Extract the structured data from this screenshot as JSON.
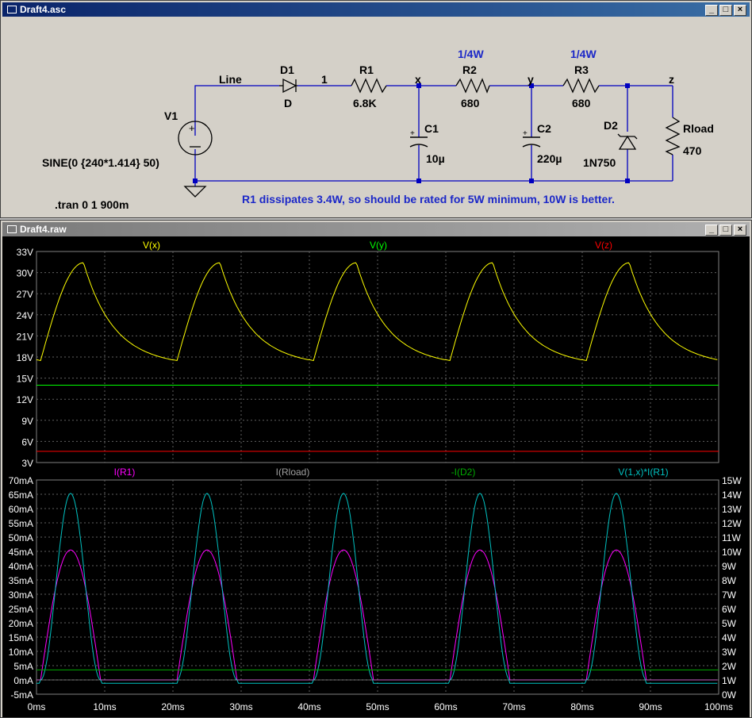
{
  "schematic_window": {
    "title": "Draft4.asc",
    "controls": {
      "minimize": "_",
      "restore": "□",
      "close": "×"
    },
    "components": {
      "V1": {
        "name": "V1",
        "value": "SINE(0 {240*1.414} 50)"
      },
      "D1": {
        "name": "D1",
        "value": "D"
      },
      "R1": {
        "name": "R1",
        "value": "6.8K"
      },
      "R2": {
        "name": "R2",
        "value": "680",
        "rating": "1/4W"
      },
      "R3": {
        "name": "R3",
        "value": "680",
        "rating": "1/4W"
      },
      "C1": {
        "name": "C1",
        "value": "10µ"
      },
      "C2": {
        "name": "C2",
        "value": "220µ"
      },
      "D2": {
        "name": "D2",
        "value": "1N750"
      },
      "Rload": {
        "name": "Rload",
        "value": "470"
      }
    },
    "nets": {
      "line": "Line",
      "n1": "1",
      "x": "x",
      "y": "y",
      "z": "z"
    },
    "directive": ".tran 0 1 900m",
    "comment": "R1 dissipates 3.4W, so should be rated for 5W minimum, 10W is better."
  },
  "waveform_window": {
    "title": "Draft4.raw",
    "controls": {
      "minimize": "_",
      "restore": "□",
      "close": "×"
    }
  },
  "chart_data": [
    {
      "type": "line",
      "pane": "top",
      "series": [
        {
          "name": "V(x)",
          "color": "#ffff00",
          "desc": "ripple 17.5V to 31.4V, peaks at 7ms+20n ms, valleys at 0.5ms, 20ms, 39.5ms, 60ms, 80.5ms"
        },
        {
          "name": "V(y)",
          "color": "#00ff00",
          "values_approx": 14.0
        },
        {
          "name": "V(z)",
          "color": "#ff0000",
          "values_approx": 4.6
        }
      ],
      "ylim": [
        3,
        33
      ],
      "y_ticks": [
        "33V",
        "30V",
        "27V",
        "24V",
        "21V",
        "18V",
        "15V",
        "12V",
        "9V",
        "6V",
        "3V"
      ],
      "xlim": [
        0,
        100
      ]
    },
    {
      "type": "line",
      "pane": "bottom",
      "series": [
        {
          "name": "I(R1)",
          "color": "#ff00ff",
          "peak": 45.5,
          "unit": "mA"
        },
        {
          "name": "I(Rload)",
          "color": "#a0a0a0",
          "value": 0,
          "unit": "mA"
        },
        {
          "name": "-I(D2)",
          "color": "#00aa00",
          "value": 3.5,
          "unit": "mA"
        },
        {
          "name": "V(1,x)*I(R1)",
          "color": "#00c0c0",
          "peak": 14.0,
          "unit": "W"
        }
      ],
      "ylim_left": [
        -5,
        70
      ],
      "y_ticks_left": [
        "70mA",
        "65mA",
        "60mA",
        "55mA",
        "50mA",
        "45mA",
        "40mA",
        "35mA",
        "30mA",
        "25mA",
        "20mA",
        "15mA",
        "10mA",
        "5mA",
        "0mA",
        "-5mA"
      ],
      "ylim_right": [
        0,
        15
      ],
      "y_ticks_right": [
        "15W",
        "14W",
        "13W",
        "12W",
        "11W",
        "10W",
        "9W",
        "8W",
        "7W",
        "6W",
        "5W",
        "4W",
        "3W",
        "2W",
        "1W",
        "0W"
      ],
      "xlim": [
        0,
        100
      ],
      "x_ticks": [
        "0ms",
        "10ms",
        "20ms",
        "30ms",
        "40ms",
        "50ms",
        "60ms",
        "70ms",
        "80ms",
        "90ms",
        "100ms"
      ]
    }
  ]
}
